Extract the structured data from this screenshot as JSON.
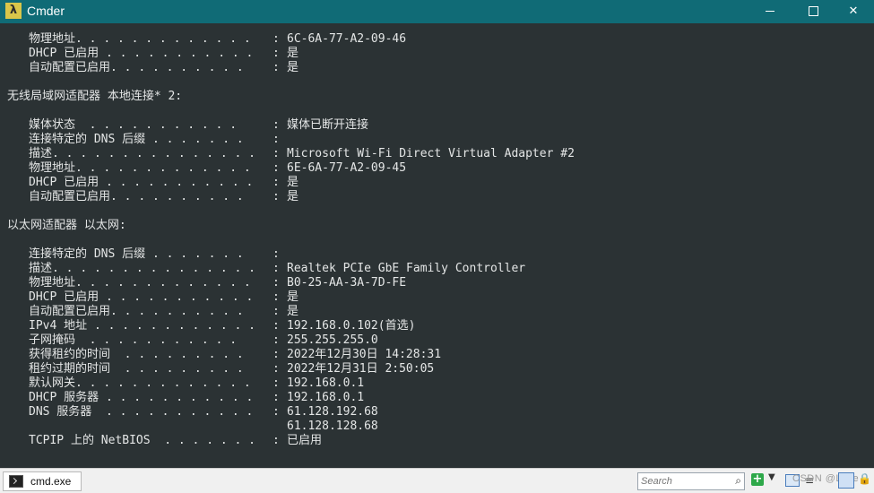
{
  "window": {
    "title": "Cmder",
    "app_icon": "λ",
    "minimize_icon": "minimize-icon",
    "maximize_icon": "maximize-icon",
    "close_icon": "close-icon",
    "close_glyph": "✕"
  },
  "console": {
    "lines": [
      {
        "type": "kv",
        "label": "物理地址",
        "dots": ". . . . . . . . . . . . . ",
        "value": "6C-6A-77-A2-09-46"
      },
      {
        "type": "kv",
        "label": "DHCP 已启用",
        "dots": " . . . . . . . . . . . ",
        "value": "是"
      },
      {
        "type": "kv",
        "label": "自动配置已启用",
        "dots": ". . . . . . . . . . ",
        "value": "是"
      },
      {
        "type": "blank"
      },
      {
        "type": "header",
        "text": "无线局域网适配器 本地连接* 2:"
      },
      {
        "type": "blank"
      },
      {
        "type": "kv",
        "label": "媒体状态",
        "dots": "  . . . . . . . . . . . ",
        "value": "媒体已断开连接"
      },
      {
        "type": "kv",
        "label": "连接特定的 DNS 后缀",
        "dots": " . . . . . . . ",
        "value": ""
      },
      {
        "type": "kv",
        "label": "描述",
        "dots": ". . . . . . . . . . . . . . . ",
        "value": "Microsoft Wi-Fi Direct Virtual Adapter #2"
      },
      {
        "type": "kv",
        "label": "物理地址",
        "dots": ". . . . . . . . . . . . . ",
        "value": "6E-6A-77-A2-09-45"
      },
      {
        "type": "kv",
        "label": "DHCP 已启用",
        "dots": " . . . . . . . . . . . ",
        "value": "是"
      },
      {
        "type": "kv",
        "label": "自动配置已启用",
        "dots": ". . . . . . . . . . ",
        "value": "是"
      },
      {
        "type": "blank"
      },
      {
        "type": "header",
        "text": "以太网适配器 以太网:"
      },
      {
        "type": "blank"
      },
      {
        "type": "kv",
        "label": "连接特定的 DNS 后缀",
        "dots": " . . . . . . . ",
        "value": ""
      },
      {
        "type": "kv",
        "label": "描述",
        "dots": ". . . . . . . . . . . . . . . ",
        "value": "Realtek PCIe GbE Family Controller"
      },
      {
        "type": "kv",
        "label": "物理地址",
        "dots": ". . . . . . . . . . . . . ",
        "value": "B0-25-AA-3A-7D-FE"
      },
      {
        "type": "kv",
        "label": "DHCP 已启用",
        "dots": " . . . . . . . . . . . ",
        "value": "是"
      },
      {
        "type": "kv",
        "label": "自动配置已启用",
        "dots": ". . . . . . . . . . ",
        "value": "是"
      },
      {
        "type": "kv",
        "label": "IPv4 地址",
        "dots": " . . . . . . . . . . . . ",
        "value": "192.168.0.102(首选)"
      },
      {
        "type": "kv",
        "label": "子网掩码",
        "dots": "  . . . . . . . . . . . ",
        "value": "255.255.255.0"
      },
      {
        "type": "kv",
        "label": "获得租约的时间",
        "dots": "  . . . . . . . . . ",
        "value": "2022年12月30日 14:28:31"
      },
      {
        "type": "kv",
        "label": "租约过期的时间",
        "dots": "  . . . . . . . . . ",
        "value": "2022年12月31日 2:50:05"
      },
      {
        "type": "kv",
        "label": "默认网关",
        "dots": ". . . . . . . . . . . . . ",
        "value": "192.168.0.1"
      },
      {
        "type": "kv",
        "label": "DHCP 服务器",
        "dots": " . . . . . . . . . . . ",
        "value": "192.168.0.1"
      },
      {
        "type": "kv",
        "label": "DNS 服务器",
        "dots": "  . . . . . . . . . . . ",
        "value": "61.128.192.68"
      },
      {
        "type": "cont",
        "value": "61.128.128.68"
      },
      {
        "type": "kv",
        "label": "TCPIP 上的 NetBIOS",
        "dots": "  . . . . . . . ",
        "value": "已启用"
      }
    ]
  },
  "statusbar": {
    "tab_label": "cmd.exe",
    "search_placeholder": "Search",
    "search_glyph": "⌕",
    "plus_glyph": "+",
    "dropdown_glyph": "▼",
    "menu_glyph": "≡",
    "watermark": "CSDN @Livfe",
    "lock_glyph": "🔒"
  }
}
